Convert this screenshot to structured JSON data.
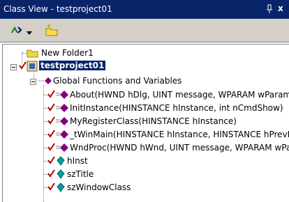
{
  "window": {
    "title": "Class View - testproject01",
    "close_glyph": "x"
  },
  "toolbar": {
    "buttons": [
      {
        "name": "sort-icon"
      },
      {
        "name": "dropdown-arrow-icon"
      },
      {
        "name": "new-folder-icon"
      }
    ]
  },
  "tree": {
    "folder": "New Folder1",
    "project": "testproject01",
    "globals": "Global Functions and Variables",
    "functions": [
      "About(HWND hDlg, UINT message, WPARAM wParam, LPARAM lParam)",
      "InitInstance(HINSTANCE hInstance, int nCmdShow)",
      "MyRegisterClass(HINSTANCE hInstance)",
      "_tWinMain(HINSTANCE hInstance, HINSTANCE hPrevInstance, LPTSTR lpCmdLine, int nCmdShow)",
      "WndProc(HWND hWnd, UINT message, WPARAM wParam, LPARAM lParam)"
    ],
    "variables": [
      "hInst",
      "szTitle",
      "szWindowClass"
    ]
  },
  "colors": {
    "title_bg": "#0a246a",
    "panel_bg": "#d4d0c8",
    "check": "#b00000",
    "func": "#800080",
    "var": "#008080"
  }
}
